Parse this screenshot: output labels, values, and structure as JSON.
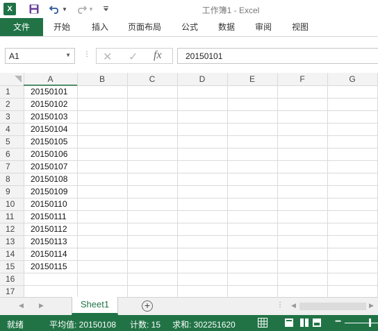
{
  "window": {
    "title": "工作簿1 - Excel",
    "logo_letter": "X"
  },
  "quick_access": {
    "icons": [
      "excel-logo-icon",
      "save-icon",
      "undo-icon",
      "redo-icon",
      "customize-icon"
    ]
  },
  "ribbon": {
    "tabs": [
      {
        "label": "文件",
        "left": 0
      },
      {
        "label": "开始",
        "left": 0
      },
      {
        "label": "插入",
        "left": 0
      },
      {
        "label": "页面布局",
        "left": 0
      },
      {
        "label": "公式",
        "left": 0
      },
      {
        "label": "数据",
        "left": 0
      },
      {
        "label": "审阅",
        "left": 0
      },
      {
        "label": "视图",
        "left": 0
      }
    ]
  },
  "formula_bar": {
    "namebox": "A1",
    "fx_label": "fx",
    "value": "20150101"
  },
  "grid": {
    "columns": [
      "A",
      "B",
      "C",
      "D",
      "E",
      "F",
      "G"
    ],
    "rows": [
      "1",
      "2",
      "3",
      "4",
      "5",
      "6",
      "7",
      "8",
      "9",
      "10",
      "11",
      "12",
      "13",
      "14",
      "15",
      "16",
      "17"
    ],
    "column_a_values": [
      "20150101",
      "20150102",
      "20150103",
      "20150104",
      "20150105",
      "20150106",
      "20150107",
      "20150108",
      "20150109",
      "20150110",
      "20150111",
      "20150112",
      "20150113",
      "20150114",
      "20150115"
    ]
  },
  "sheets": {
    "active": "Sheet1",
    "add_label": "+"
  },
  "status": {
    "ready": "就绪",
    "average": "平均值: 20150108",
    "count": "计数: 15",
    "sum": "求和: 302251620",
    "accent": "#217346"
  }
}
